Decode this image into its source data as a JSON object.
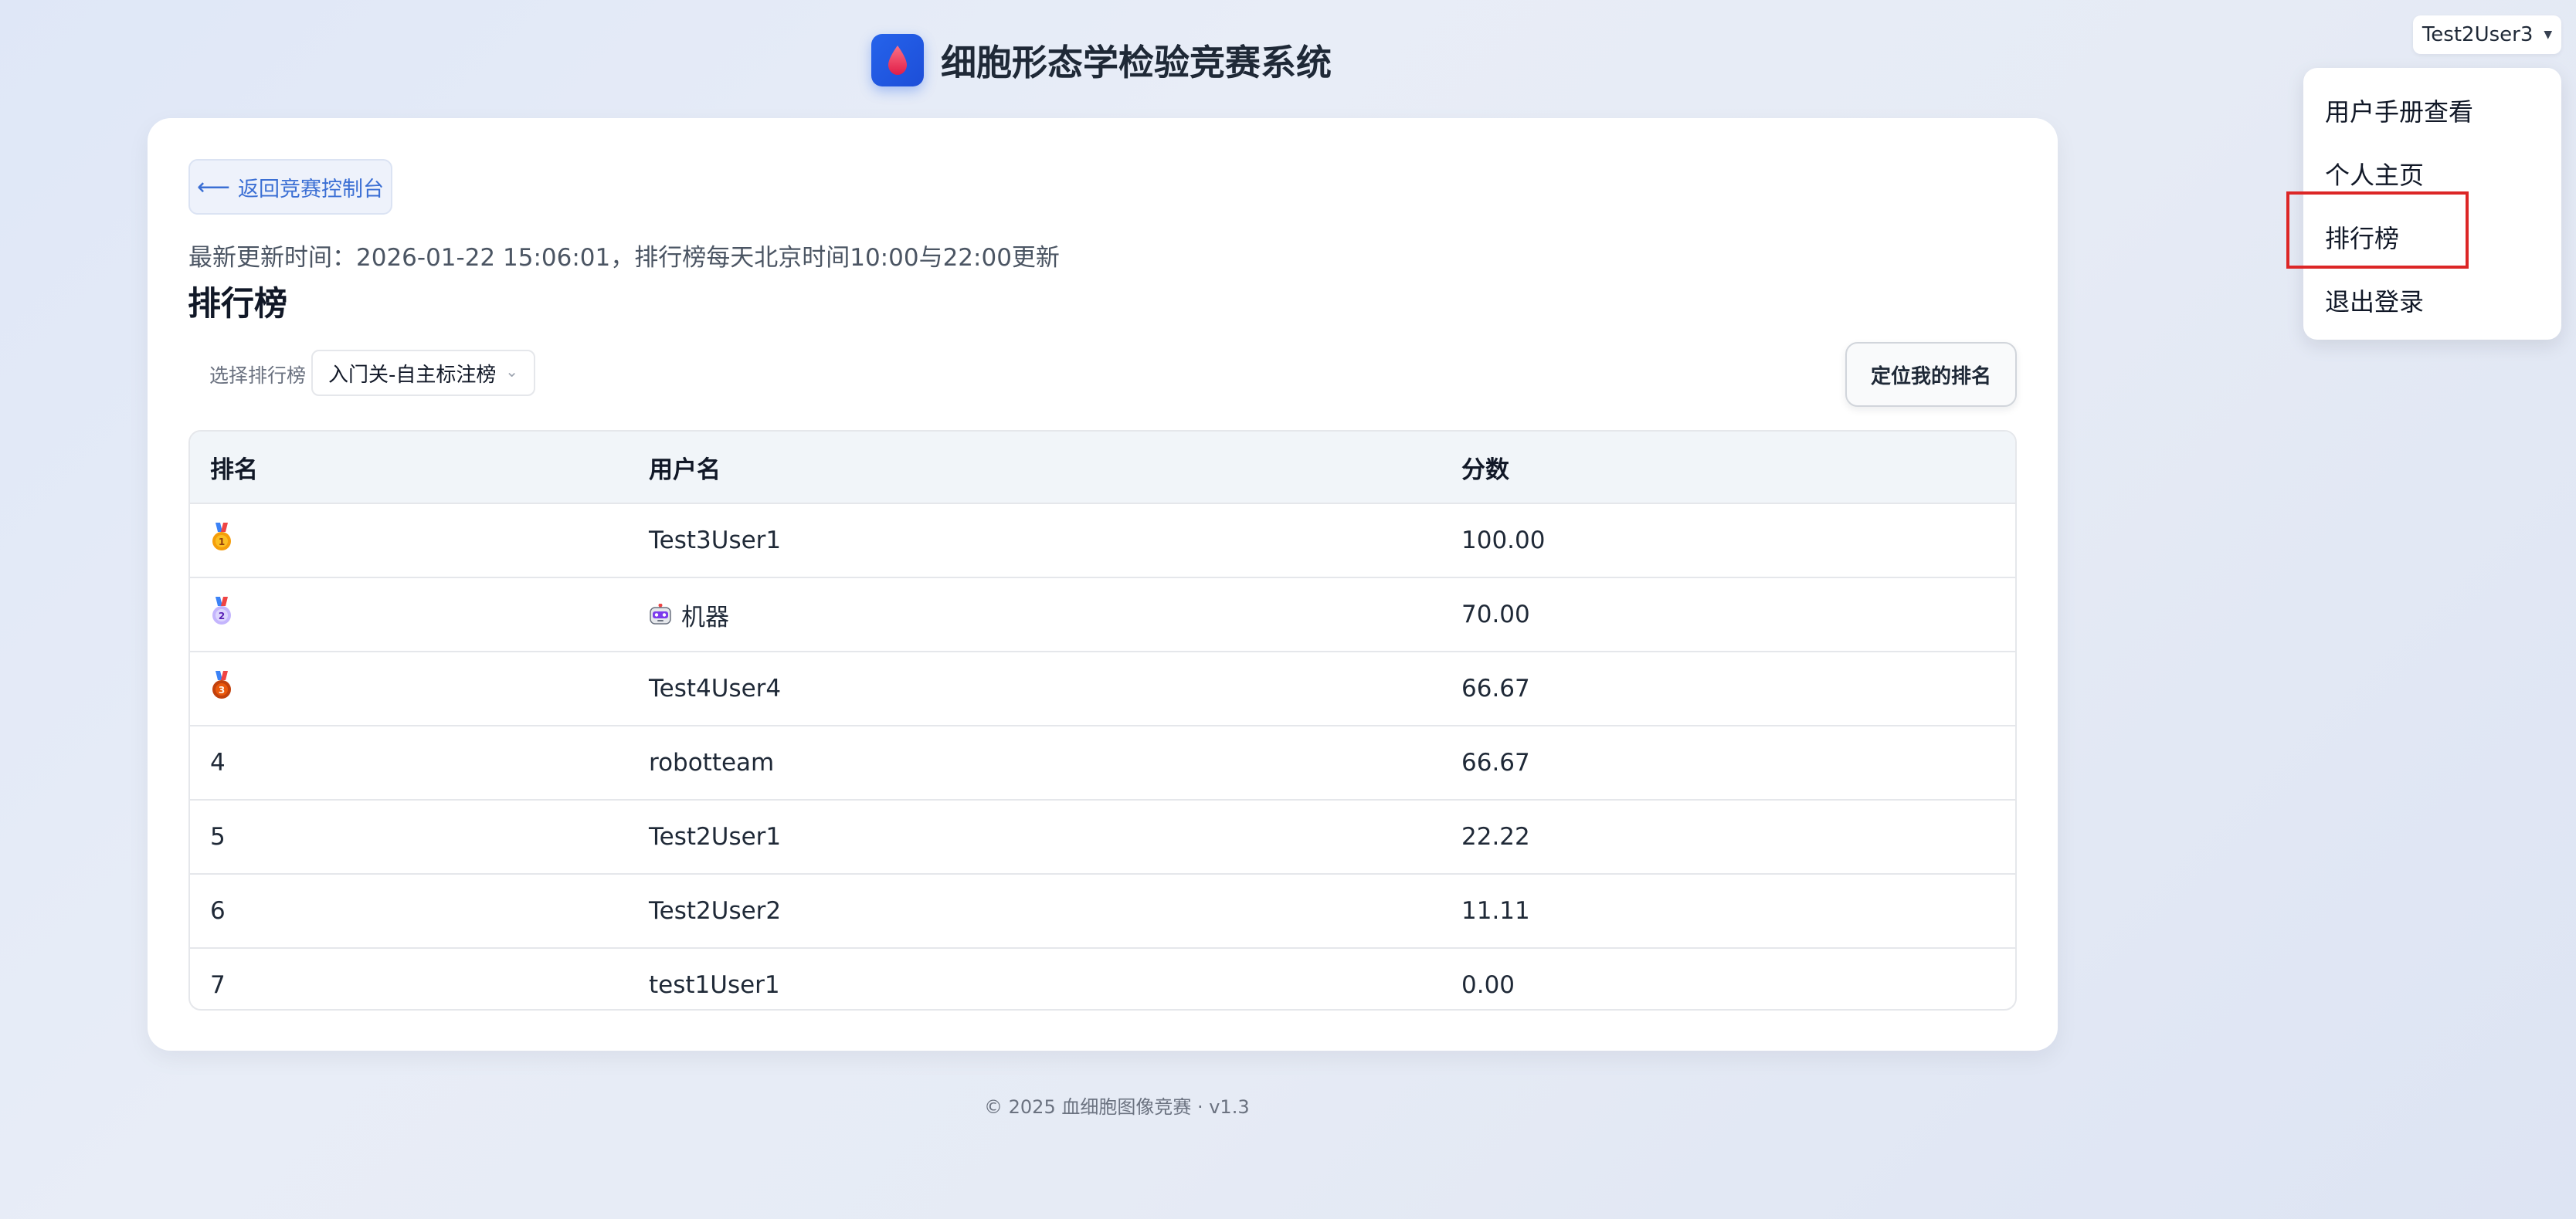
{
  "header": {
    "title": "细胞形态学检验竞赛系统",
    "logo_icon": "blood-drop-icon"
  },
  "user_menu": {
    "username": "Test2User3",
    "items": [
      {
        "label": "用户手册查看"
      },
      {
        "label": "个人主页"
      },
      {
        "label": "排行榜"
      },
      {
        "label": "退出登录"
      }
    ],
    "highlighted_item": "排行榜",
    "highlight_color": "#dc2626"
  },
  "main": {
    "back_button": "返回竞赛控制台",
    "update_text": "最新更新时间：2026-01-22 15:06:01，排行榜每天北京时间10:00与22:00更新",
    "page_title": "排行榜",
    "select_label": "选择排行榜",
    "select_value": "入门关-自主标注榜",
    "locate_button": "定位我的排名"
  },
  "table": {
    "columns": [
      "排名",
      "用户名",
      "分数"
    ],
    "rows": [
      {
        "rank": "gold-medal-icon",
        "username": "Test3User1",
        "score": "100.00"
      },
      {
        "rank": "silver-medal-icon",
        "username": "机器",
        "user_icon": "robot-icon",
        "score": "70.00"
      },
      {
        "rank": "bronze-medal-icon",
        "username": "Test4User4",
        "score": "66.67"
      },
      {
        "rank": "4",
        "username": "robotteam",
        "score": "66.67"
      },
      {
        "rank": "5",
        "username": "Test2User1",
        "score": "22.22"
      },
      {
        "rank": "6",
        "username": "Test2User2",
        "score": "11.11"
      },
      {
        "rank": "7",
        "username": "test1User1",
        "score": "0.00"
      }
    ]
  },
  "footer": {
    "text": "© 2025 血细胞图像竞赛 · v1.3"
  },
  "colors": {
    "accent": "#2563eb",
    "link": "#3b6fd4",
    "gold": "#f59e0b",
    "silver": "#a78bfa",
    "bronze": "#c2410c"
  }
}
